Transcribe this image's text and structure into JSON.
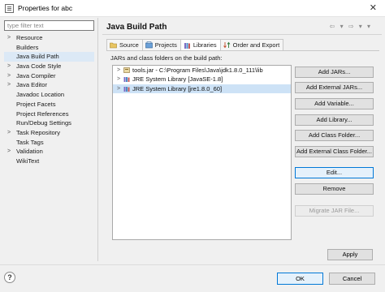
{
  "window": {
    "title": "Properties for abc",
    "close_glyph": "✕"
  },
  "filter": {
    "placeholder": "type filter text"
  },
  "sidebar": {
    "items": [
      {
        "label": "Resource",
        "expandable": true
      },
      {
        "label": "Builders",
        "expandable": false
      },
      {
        "label": "Java Build Path",
        "expandable": false,
        "selected": true
      },
      {
        "label": "Java Code Style",
        "expandable": true
      },
      {
        "label": "Java Compiler",
        "expandable": true
      },
      {
        "label": "Java Editor",
        "expandable": true
      },
      {
        "label": "Javadoc Location",
        "expandable": false
      },
      {
        "label": "Project Facets",
        "expandable": false
      },
      {
        "label": "Project References",
        "expandable": false
      },
      {
        "label": "Run/Debug Settings",
        "expandable": false
      },
      {
        "label": "Task Repository",
        "expandable": true
      },
      {
        "label": "Task Tags",
        "expandable": false
      },
      {
        "label": "Validation",
        "expandable": true
      },
      {
        "label": "WikiText",
        "expandable": false
      }
    ]
  },
  "page": {
    "title": "Java Build Path",
    "nav_arrows": "⇦ ▾ ⇨ ▾ ▾",
    "tabs": [
      {
        "label": "Source",
        "icon": "source-folder-icon"
      },
      {
        "label": "Projects",
        "icon": "projects-icon"
      },
      {
        "label": "Libraries",
        "icon": "libraries-icon",
        "active": true
      },
      {
        "label": "Order and Export",
        "icon": "order-export-icon"
      }
    ],
    "jars_label": "JARs and class folders on the build path:",
    "entries": [
      {
        "label": "tools.jar - C:\\Program Files\\Java\\jdk1.8.0_111\\lib",
        "icon": "jar-icon"
      },
      {
        "label": "JRE System Library [JavaSE-1.8]",
        "icon": "library-icon"
      },
      {
        "label": "JRE System Library [jre1.8.0_60]",
        "icon": "library-icon",
        "selected": true
      }
    ]
  },
  "buttons": {
    "add_jars": "Add JARs...",
    "add_external_jars": "Add External JARs...",
    "add_variable": "Add Variable...",
    "add_library": "Add Library...",
    "add_class_folder": "Add Class Folder...",
    "add_external_class_folder": "Add External Class Folder...",
    "edit": "Edit...",
    "remove": "Remove",
    "migrate_jar": "Migrate JAR File..."
  },
  "footer": {
    "apply": "Apply",
    "ok": "OK",
    "cancel": "Cancel",
    "help": "?"
  }
}
